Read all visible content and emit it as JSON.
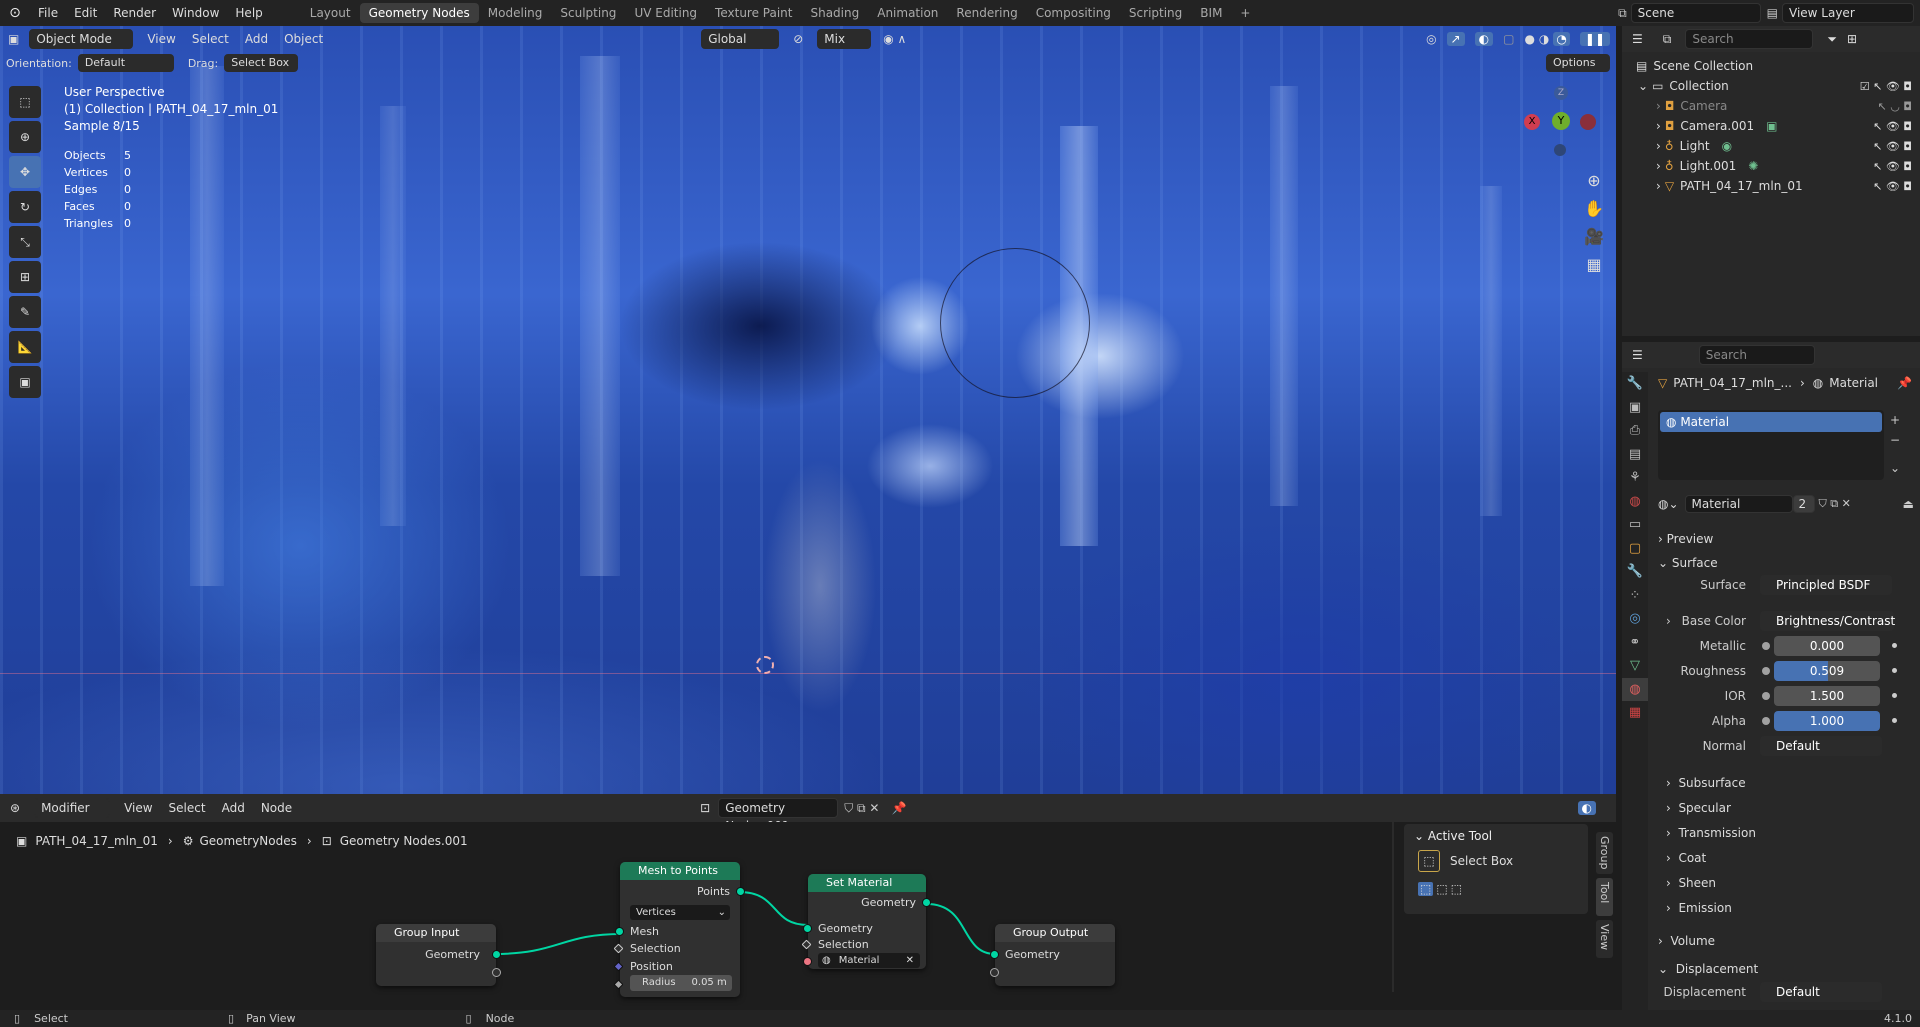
{
  "topbar": {
    "menus": [
      "File",
      "Edit",
      "Render",
      "Window",
      "Help"
    ],
    "tabs": [
      "Layout",
      "Geometry Nodes",
      "Modeling",
      "Sculpting",
      "UV Editing",
      "Texture Paint",
      "Shading",
      "Animation",
      "Rendering",
      "Compositing",
      "Scripting",
      "BIM"
    ],
    "active_tab": "Geometry Nodes",
    "add_tab": "+",
    "scene": "Scene",
    "view_layer": "View Layer"
  },
  "viewport": {
    "mode": "Object Mode",
    "menus": [
      "View",
      "Select",
      "Add",
      "Object"
    ],
    "transform_orientation": "Global",
    "snap": "Mix",
    "orientation_label": "Orientation:",
    "orientation_value": "Default",
    "drag_label": "Drag:",
    "drag_value": "Select Box",
    "options": "Options",
    "view_name": "User Perspective",
    "collection_info": "(1) Collection | PATH_04_17_mln_01",
    "sample": "Sample 8/15",
    "stats": [
      {
        "k": "Objects",
        "v": "5"
      },
      {
        "k": "Vertices",
        "v": "0"
      },
      {
        "k": "Edges",
        "v": "0"
      },
      {
        "k": "Faces",
        "v": "0"
      },
      {
        "k": "Triangles",
        "v": "0"
      }
    ],
    "gizmo": {
      "x": "X",
      "y": "Y",
      "z": "Z"
    }
  },
  "node_editor": {
    "editor_type": "Modifier",
    "menus": [
      "View",
      "Select",
      "Add",
      "Node"
    ],
    "node_tree": "Geometry Nodes.001",
    "breadcrumb": [
      "PATH_04_17_mln_01",
      "GeometryNodes",
      "Geometry Nodes.001"
    ],
    "nodes": {
      "group_input": {
        "title": "Group Input",
        "geometry": "Geometry"
      },
      "mesh_to_points": {
        "title": "Mesh to Points",
        "points": "Points",
        "mode": "Vertices",
        "mesh": "Mesh",
        "selection": "Selection",
        "position": "Position",
        "radius_label": "Radius",
        "radius_value": "0.05 m"
      },
      "set_material": {
        "title": "Set Material",
        "geometry_out": "Geometry",
        "geometry_in": "Geometry",
        "selection": "Selection",
        "material": "Material"
      },
      "group_output": {
        "title": "Group Output",
        "geometry": "Geometry"
      }
    },
    "sidebar": {
      "title": "Active Tool",
      "tool": "Select Box",
      "tabs": [
        "Group",
        "Tool",
        "View"
      ]
    }
  },
  "outliner": {
    "search_placeholder": "Search",
    "root": "Scene Collection",
    "collection": "Collection",
    "items": [
      "Camera",
      "Camera.001",
      "Light",
      "Light.001",
      "PATH_04_17_mln_01"
    ]
  },
  "properties": {
    "search_placeholder": "Search",
    "breadcrumb_object": "PATH_04_17_mln_...",
    "breadcrumb_tab": "Material",
    "slot": "Material",
    "material_name": "Material",
    "users": "2",
    "sections": {
      "preview": "Preview",
      "surface": "Surface",
      "subsurface": "Subsurface",
      "specular": "Specular",
      "transmission": "Transmission",
      "coat": "Coat",
      "sheen": "Sheen",
      "emission": "Emission",
      "volume": "Volume",
      "displacement": "Displacement"
    },
    "surface_label": "Surface",
    "surface_value": "Principled BSDF",
    "base_color_label": "Base Color",
    "base_color_value": "Brightness/Contrast",
    "metallic_label": "Metallic",
    "metallic_value": "0.000",
    "roughness_label": "Roughness",
    "roughness_value": "0.509",
    "roughness_fraction": 0.509,
    "ior_label": "IOR",
    "ior_value": "1.500",
    "alpha_label": "Alpha",
    "alpha_value": "1.000",
    "alpha_fraction": 1.0,
    "normal_label": "Normal",
    "normal_value": "Default",
    "displacement_label": "Displacement",
    "displacement_value": "Default"
  },
  "statusbar": {
    "select": "Select",
    "pan": "Pan View",
    "node": "Node",
    "version": "4.1.0"
  },
  "colors": {
    "accent": "#4772b3",
    "node_green": "#00d6a3",
    "geometry_header": "#1d7a57"
  }
}
